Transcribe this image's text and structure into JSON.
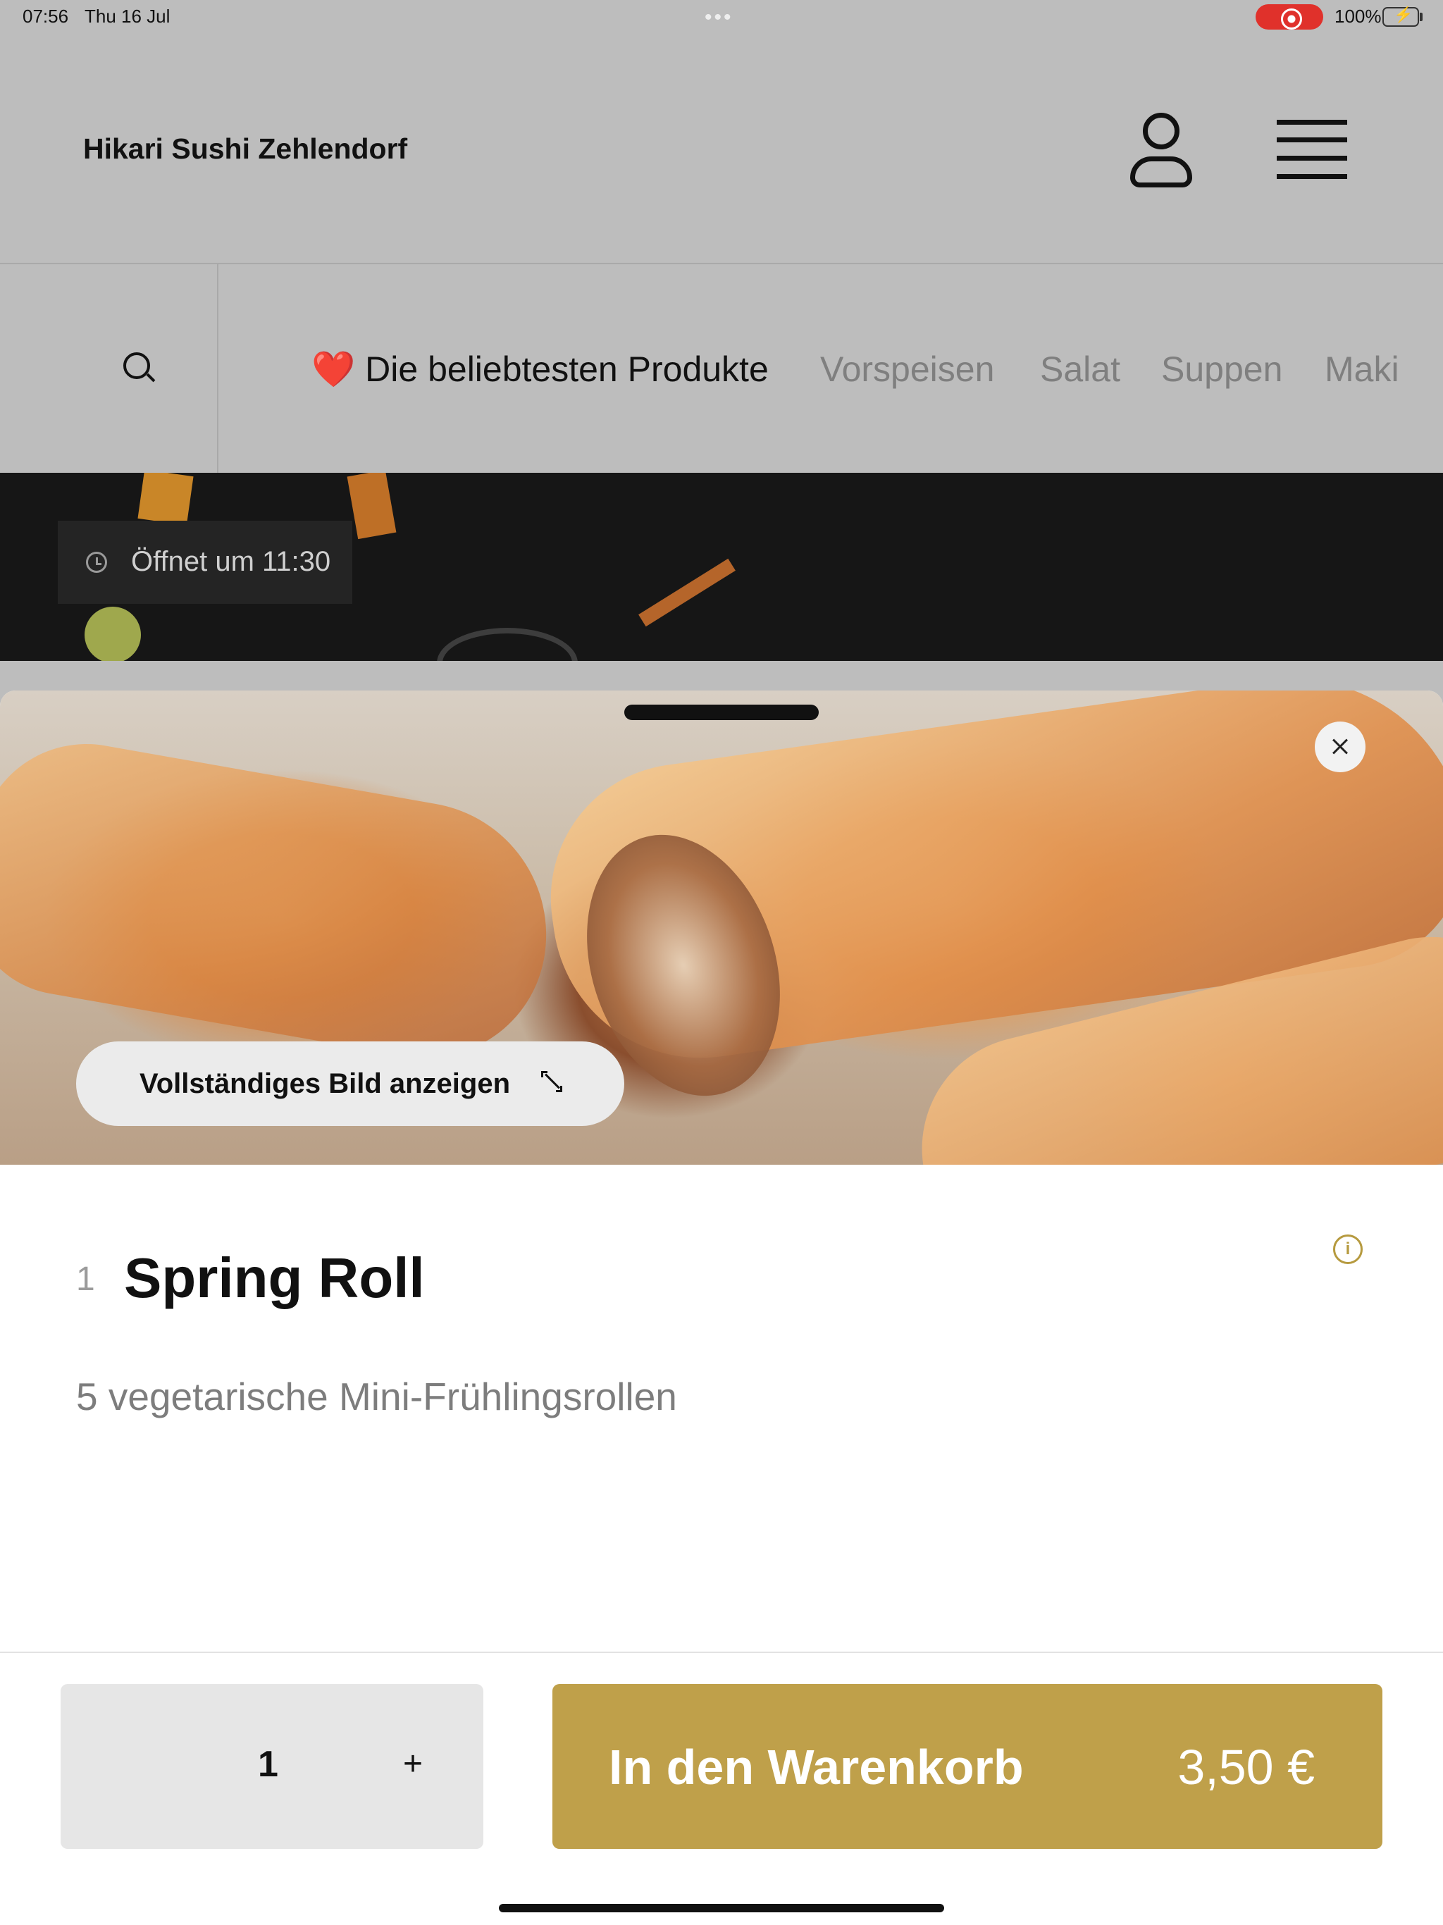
{
  "status_bar": {
    "time": "07:56",
    "date": "Thu 16 Jul",
    "battery_percent": "100%"
  },
  "header": {
    "brand": "Hikari Sushi Zehlendorf",
    "user_icon": "user-icon",
    "menu_icon": "hamburger-menu-icon"
  },
  "categories": {
    "search_icon": "search-icon",
    "active": {
      "emoji": "❤️",
      "label": "Die beliebtesten Produkte"
    },
    "items": [
      "Vorspeisen",
      "Salat",
      "Suppen",
      "Maki"
    ]
  },
  "hero": {
    "opening_text": "Öffnet um 11:30"
  },
  "product": {
    "full_image_button": "Vollständiges Bild anzeigen",
    "number": "1",
    "title": "Spring Roll",
    "description": "5 vegetarische Mini-Frühlingsrollen",
    "info_icon_glyph": "i"
  },
  "footer": {
    "quantity": "1",
    "plus_label": "+",
    "add_to_cart_label": "In den Warenkorb",
    "price": "3,50 €"
  },
  "colors": {
    "accent": "#bfa04a",
    "recording": "#e0312b",
    "heart": "#d62b27"
  }
}
